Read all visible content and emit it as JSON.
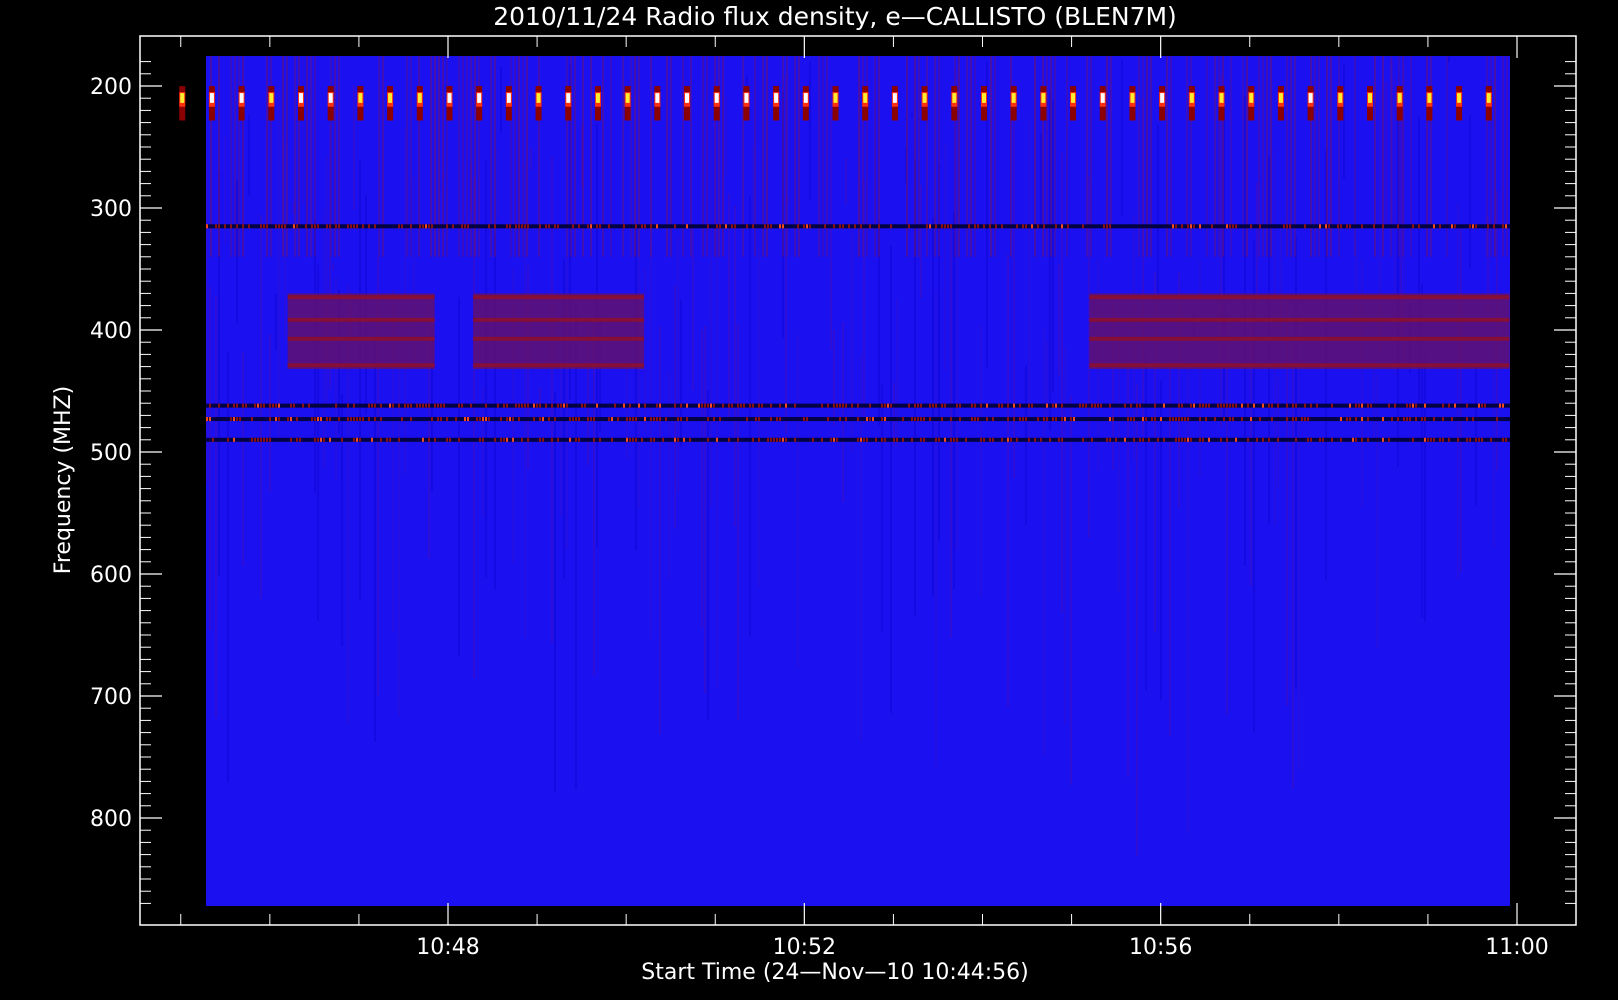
{
  "chart_data": {
    "type": "heatmap",
    "title": "2010/11/24  Radio flux density, e—CALLISTO (BLEN7M)",
    "xlabel": "Start Time (24—Nov—10 10:44:56)",
    "ylabel": "Frequency (MHZ)",
    "x_ticks": [
      "10:48",
      "10:52",
      "10:56",
      "11:00"
    ],
    "y_ticks": [
      "200",
      "300",
      "400",
      "500",
      "600",
      "700",
      "800"
    ],
    "x_range": [
      "10:44:56",
      "10:59:55"
    ],
    "y_range_mhz": [
      178,
      870
    ],
    "y_axis_inverted": true,
    "colormap": [
      "#000000",
      "#0000ff",
      "#8b0000",
      "#ff0000",
      "#ffff00",
      "#ffffff"
    ],
    "background_color": "#1a10f0",
    "features": [
      {
        "kind": "periodic bursts",
        "freq_mhz": [
          205,
          225
        ],
        "period_s": 20
      },
      {
        "kind": "horizontal band",
        "freq_mhz": 315
      },
      {
        "kind": "interference band",
        "freq_mhz": [
          370,
          432
        ],
        "time": [
          "10:46:12",
          "10:47:51"
        ]
      },
      {
        "kind": "interference band",
        "freq_mhz": [
          370,
          432
        ],
        "time": [
          "10:48:17",
          "10:50:12"
        ]
      },
      {
        "kind": "interference band",
        "freq_mhz": [
          370,
          432
        ],
        "time": [
          "10:55:12",
          "10:59:55"
        ]
      },
      {
        "kind": "horizontal band",
        "freq_mhz": 462
      },
      {
        "kind": "horizontal band",
        "freq_mhz": 473
      },
      {
        "kind": "horizontal band",
        "freq_mhz": 490
      }
    ]
  }
}
